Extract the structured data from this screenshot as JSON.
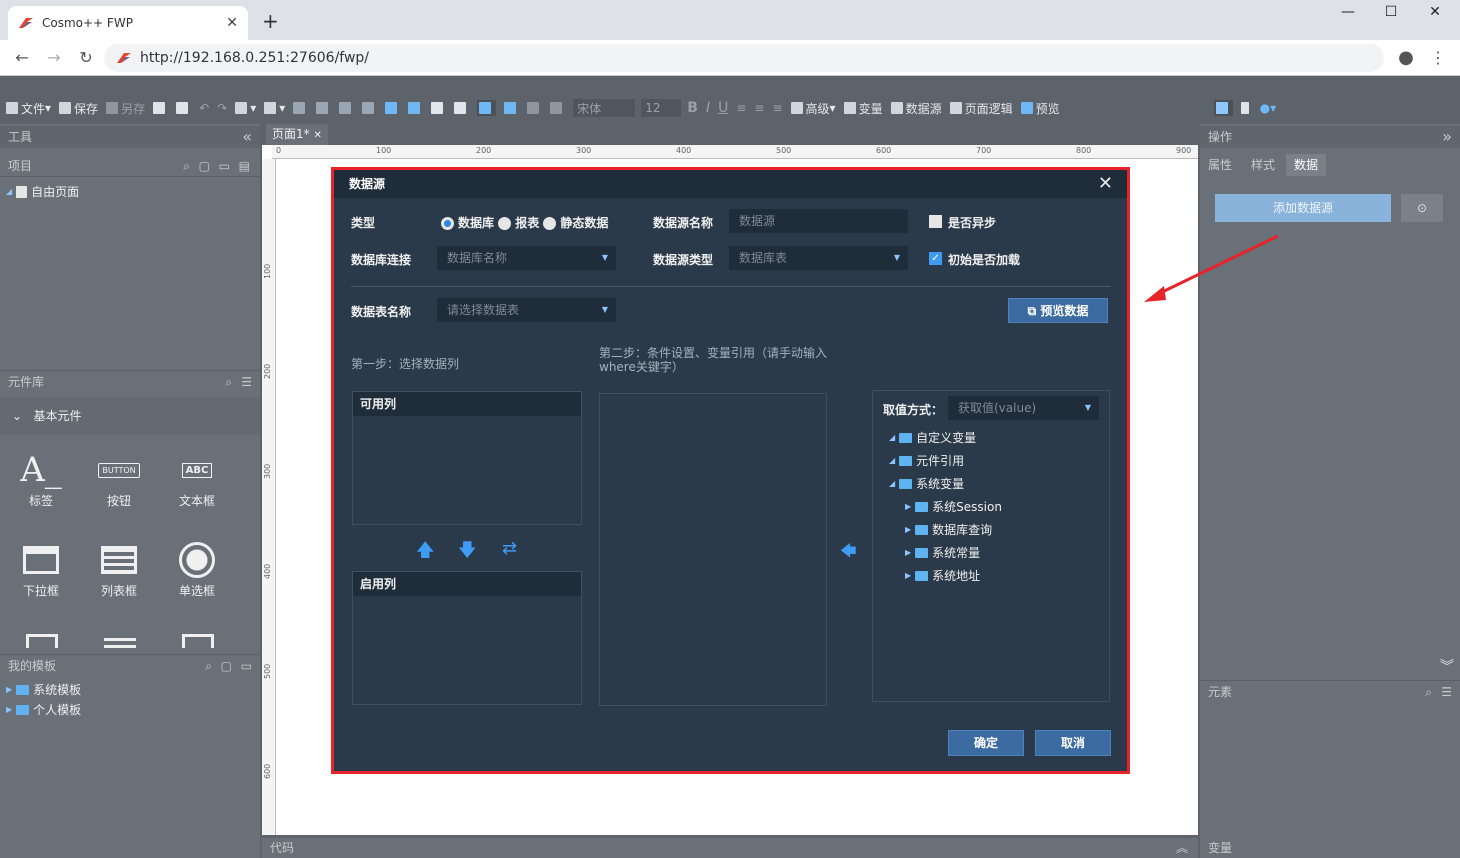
{
  "browser": {
    "tab_title": "Cosmo++ FWP",
    "url": "http://192.168.0.251:27606/fwp/",
    "new_tab": "+"
  },
  "toolbar": {
    "file": "文件",
    "save": "保存",
    "save_as": "另存",
    "font": "宋体",
    "font_size": "12",
    "advanced": "高级",
    "variable": "变量",
    "datasource": "数据源",
    "page_logic": "页面逻辑",
    "preview": "预览"
  },
  "left": {
    "tools_title": "工具",
    "project_title": "项目",
    "project_item": "自由页面",
    "library_title": "元件库",
    "basic_components": "基本元件",
    "components": [
      "标签",
      "按钮",
      "文本框",
      "下拉框",
      "列表框",
      "单选框"
    ],
    "button_glyph": "BUTTON",
    "textbox_glyph": "ABC",
    "templates_title": "我的模板",
    "templates": [
      "系统模板",
      "个人模板"
    ]
  },
  "canvas": {
    "tab": "页面1*",
    "ruler_top": [
      "0",
      "100",
      "200",
      "300",
      "400",
      "500",
      "600",
      "700",
      "800",
      "900"
    ],
    "ruler_left": [
      "100",
      "200",
      "300",
      "400",
      "500",
      "600"
    ]
  },
  "right": {
    "ops_title": "操作",
    "tabs": [
      "属性",
      "样式",
      "数据"
    ],
    "add_datasource": "添加数据源",
    "elements_title": "元素",
    "variables_title": "变量"
  },
  "bottom": {
    "code_title": "代码"
  },
  "dialog": {
    "title": "数据源",
    "type_label": "类型",
    "type_options": [
      "数据库",
      "报表",
      "静态数据"
    ],
    "ds_name_label": "数据源名称",
    "ds_name_placeholder": "数据源",
    "async_label": "是否异步",
    "db_conn_label": "数据库连接",
    "db_conn_placeholder": "数据库名称",
    "ds_type_label": "数据源类型",
    "ds_type_placeholder": "数据库表",
    "init_load_label": "初始是否加载",
    "table_label": "数据表名称",
    "table_placeholder": "请选择数据表",
    "preview_btn": "预览数据",
    "step1": "第一步：选择数据列",
    "step2_line1": "第二步：条件设置、变量引用（请手动输入",
    "step2_line2": "where关键字）",
    "available_cols": "可用列",
    "enabled_cols": "启用列",
    "value_mode_label": "取值方式：",
    "value_mode_placeholder": "获取值(value)",
    "tree": [
      "自定义变量",
      "元件引用",
      "系统变量",
      "系统Session",
      "数据库查询",
      "系统常量",
      "系统地址"
    ],
    "ok": "确定",
    "cancel": "取消"
  }
}
